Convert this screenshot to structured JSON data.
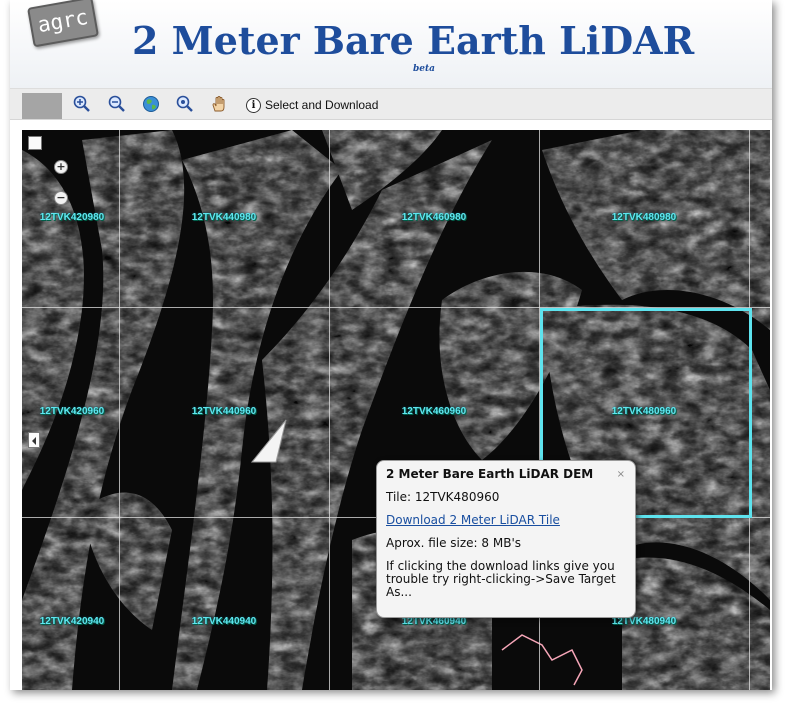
{
  "header": {
    "logo_text": "agrc",
    "title": "2 Meter Bare Earth LiDAR",
    "subtitle": "beta"
  },
  "toolbar": {
    "buttons": [
      {
        "name": "zoom-in-icon"
      },
      {
        "name": "zoom-out-icon"
      },
      {
        "name": "globe-icon"
      },
      {
        "name": "zoom-to-icon"
      },
      {
        "name": "pan-hand-icon"
      }
    ],
    "select_download_label": "Select and Download",
    "info_glyph": "i"
  },
  "map": {
    "zoom_in_glyph": "+",
    "zoom_out_glyph": "−",
    "tiles": [
      {
        "label": "12TVK420980",
        "col": 0,
        "row": 0
      },
      {
        "label": "12TVK440980",
        "col": 1,
        "row": 0
      },
      {
        "label": "12TVK460980",
        "col": 2,
        "row": 0
      },
      {
        "label": "12TVK480980",
        "col": 3,
        "row": 0
      },
      {
        "label": "12TVK420960",
        "col": 0,
        "row": 1
      },
      {
        "label": "12TVK440960",
        "col": 1,
        "row": 1
      },
      {
        "label": "12TVK460960",
        "col": 2,
        "row": 1
      },
      {
        "label": "12TVK480960",
        "col": 3,
        "row": 1
      },
      {
        "label": "12TVK420940",
        "col": 0,
        "row": 2
      },
      {
        "label": "12TVK440940",
        "col": 1,
        "row": 2
      },
      {
        "label": "12TVK460940",
        "col": 2,
        "row": 2
      },
      {
        "label": "12TVK480940",
        "col": 3,
        "row": 2
      }
    ],
    "selected_tile": "12TVK480960",
    "colors": {
      "tile_label": "#5ee8f0",
      "selection": "#5ee3ee",
      "grid": "#e1e1e1"
    }
  },
  "popup": {
    "title": "2 Meter Bare Earth LiDAR DEM",
    "close_glyph": "×",
    "tile_line": "Tile: 12TVK480960",
    "download_link": "Download 2 Meter LiDAR Tile",
    "file_size": "Aprox. file size: 8 MB's",
    "hint": "If clicking the download links give you trouble try right-clicking->Save Target As..."
  }
}
